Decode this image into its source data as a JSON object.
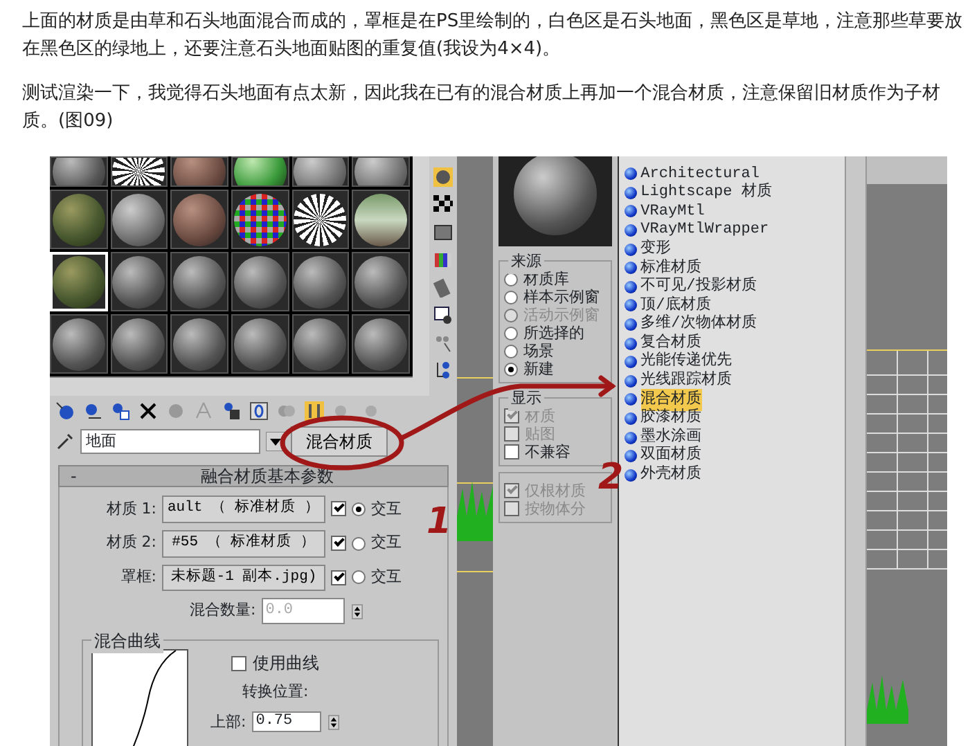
{
  "article": {
    "paragraphs": [
      "上面的材质是由草和石头地面混合而成的，罩框是在PS里绘制的，白色区是石头地面，黑色区是草地，注意那些草要放在黑色区的绿地上，还要注意石头地面贴图的重复值(我设为4×4)。",
      "测试渲染一下，我觉得石头地面有点太新，因此我在已有的混合材质上再加一个混合材质，注意保留旧材质作为子材质。(图09)"
    ]
  },
  "material_editor": {
    "sample_slots": [
      {
        "kind": "grey",
        "selected": false
      },
      {
        "kind": "noise",
        "selected": false
      },
      {
        "kind": "rust",
        "selected": false
      },
      {
        "kind": "green",
        "selected": false
      },
      {
        "kind": "stone",
        "selected": false
      },
      {
        "kind": "stone",
        "selected": false
      },
      {
        "kind": "moss",
        "selected": false
      },
      {
        "kind": "stone",
        "selected": false
      },
      {
        "kind": "rust",
        "selected": false
      },
      {
        "kind": "checker",
        "selected": false
      },
      {
        "kind": "noise",
        "selected": false
      },
      {
        "kind": "photo",
        "selected": false
      },
      {
        "kind": "moss",
        "selected": true
      },
      {
        "kind": "grey",
        "selected": false
      },
      {
        "kind": "grey",
        "selected": false
      },
      {
        "kind": "grey",
        "selected": false
      },
      {
        "kind": "grey",
        "selected": false
      },
      {
        "kind": "grey",
        "selected": false
      },
      {
        "kind": "grey",
        "selected": false
      },
      {
        "kind": "grey",
        "selected": false
      },
      {
        "kind": "grey",
        "selected": false
      },
      {
        "kind": "grey",
        "selected": false
      },
      {
        "kind": "grey",
        "selected": false
      },
      {
        "kind": "grey",
        "selected": false
      }
    ],
    "material_name": "地面",
    "material_type": "混合材质",
    "rollout": {
      "collapse_sign": "-",
      "title": "融合材质基本参数",
      "rows": [
        {
          "label": "材质 1:",
          "value": "ault  （ 标准材质 ）",
          "checked": true,
          "selected": true,
          "option": "交互"
        },
        {
          "label": "材质 2:",
          "value": "#55  （ 标准材质 ）",
          "checked": true,
          "selected": false,
          "option": "交互"
        },
        {
          "label": "罩框:",
          "value": "未标题-1 副本.jpg)",
          "checked": true,
          "selected": false,
          "option": "交互"
        }
      ],
      "mix_amount": {
        "label": "混合数量:",
        "value": "0.0",
        "disabled": true
      },
      "curve_group": {
        "title": "混合曲线",
        "use_curve": {
          "label": "使用曲线",
          "checked": false
        },
        "transition_label": "转换位置:",
        "upper": {
          "label": "上部:",
          "value": "0.75"
        }
      }
    }
  },
  "annotations": {
    "labels": [
      "1",
      "2"
    ]
  },
  "browser": {
    "source": {
      "title": "来源",
      "options": [
        {
          "label": "材质库",
          "selected": false,
          "disabled": false
        },
        {
          "label": "样本示例窗",
          "selected": false,
          "disabled": false
        },
        {
          "label": "活动示例窗",
          "selected": false,
          "disabled": true
        },
        {
          "label": "所选择的",
          "selected": false,
          "disabled": false
        },
        {
          "label": "场景",
          "selected": false,
          "disabled": false
        },
        {
          "label": "新建",
          "selected": true,
          "disabled": false
        }
      ]
    },
    "display": {
      "title": "显示",
      "options": [
        {
          "label": "材质",
          "checked": true,
          "disabled": true
        },
        {
          "label": "贴图",
          "checked": false,
          "disabled": true
        },
        {
          "label": "不兼容",
          "checked": false,
          "disabled": false
        }
      ]
    },
    "root_options": [
      {
        "label": "仅根材质",
        "checked": true,
        "disabled": true
      },
      {
        "label": "按物体分",
        "checked": false,
        "disabled": true
      }
    ],
    "material_types": [
      {
        "label": "Architectural",
        "selected": false
      },
      {
        "label": "Lightscape 材质",
        "selected": false
      },
      {
        "label": "VRayMtl",
        "selected": false
      },
      {
        "label": "VRayMtlWrapper",
        "selected": false
      },
      {
        "label": "变形",
        "selected": false
      },
      {
        "label": "标准材质",
        "selected": false
      },
      {
        "label": "不可见/投影材质",
        "selected": false
      },
      {
        "label": "顶/底材质",
        "selected": false
      },
      {
        "label": "多维/次物体材质",
        "selected": false
      },
      {
        "label": "复合材质",
        "selected": false
      },
      {
        "label": "光能传递优先",
        "selected": false
      },
      {
        "label": "光线跟踪材质",
        "selected": false
      },
      {
        "label": "混合材质",
        "selected": true
      },
      {
        "label": "胶漆材质",
        "selected": false
      },
      {
        "label": "墨水涂画",
        "selected": false
      },
      {
        "label": "双面材质",
        "selected": false
      },
      {
        "label": "外壳材质",
        "selected": false
      }
    ]
  }
}
